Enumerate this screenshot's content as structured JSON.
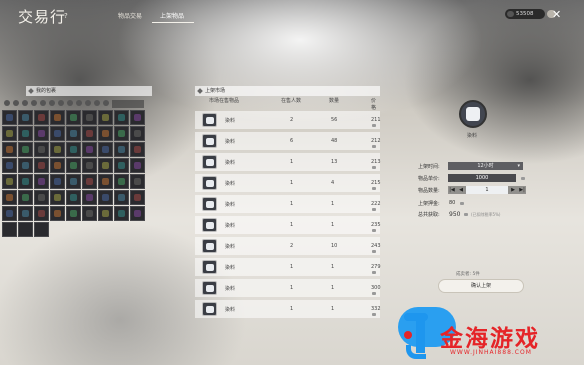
{
  "window": {
    "title": "交易行",
    "help_label": "?"
  },
  "tabs": [
    {
      "label": "物品交易",
      "active": false
    },
    {
      "label": "上架物品",
      "active": true
    }
  ],
  "currency": {
    "amount": "53508"
  },
  "close_label": "✕",
  "bag": {
    "title": "我的包裹",
    "filter_icon_count": 12,
    "rows": 8,
    "cols": 9,
    "last_row_filled": 3
  },
  "market": {
    "title": "上架市场",
    "columns": [
      "市场在售物品",
      "在售人数",
      "数量",
      "价格"
    ],
    "rows": [
      {
        "name": "染料",
        "sellers": "2",
        "qty": "56",
        "price": "211"
      },
      {
        "name": "染料",
        "sellers": "6",
        "qty": "48",
        "price": "212"
      },
      {
        "name": "染料",
        "sellers": "1",
        "qty": "13",
        "price": "213"
      },
      {
        "name": "染料",
        "sellers": "1",
        "qty": "4",
        "price": "215"
      },
      {
        "name": "染料",
        "sellers": "1",
        "qty": "1",
        "price": "222"
      },
      {
        "name": "染料",
        "sellers": "1",
        "qty": "1",
        "price": "235"
      },
      {
        "name": "染料",
        "sellers": "2",
        "qty": "10",
        "price": "243"
      },
      {
        "name": "染料",
        "sellers": "1",
        "qty": "1",
        "price": "279"
      },
      {
        "name": "染料",
        "sellers": "1",
        "qty": "1",
        "price": "300"
      },
      {
        "name": "染料",
        "sellers": "1",
        "qty": "1",
        "price": "332"
      }
    ]
  },
  "listing": {
    "item_name": "染料",
    "duration_label": "上架时间:",
    "duration_value": "12小时",
    "unit_price_label": "物品单价:",
    "unit_price_value": "1000",
    "quantity_label": "物品数量:",
    "quantity_value": "1",
    "quantity_min_label": "|◀",
    "quantity_dec_label": "◀",
    "quantity_inc_label": "▶",
    "quantity_max_label": "▶|",
    "deposit_label": "上架押金:",
    "deposit_value": "80",
    "total_label": "总共获取:",
    "total_value": "950",
    "fee_note": "(已扣除税率5%)",
    "seller_note": "成卖者: 5件",
    "confirm_label": "确认上架"
  },
  "watermark": {
    "text": "金海游戏",
    "url": "WWW.JINHAI888.COM"
  },
  "colors": {
    "accent_red": "#e52428",
    "accent_blue": "#1e96ee",
    "dark_input": "#4a4a4e"
  }
}
